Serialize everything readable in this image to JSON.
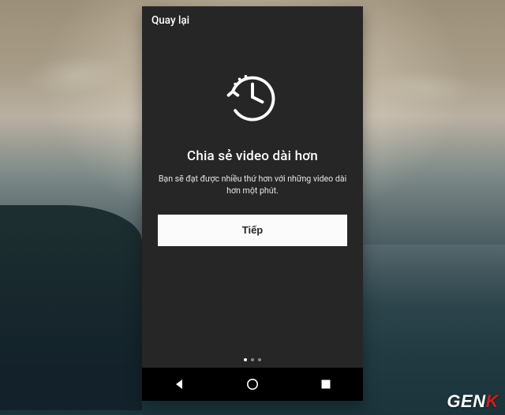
{
  "header": {
    "back": "Quay lại"
  },
  "main": {
    "icon": "clock-history-icon",
    "title": "Chia sẻ video dài hơn",
    "subtitle": "Bạn sẽ đạt được nhiều thứ hơn với những video dài hơn một phút.",
    "primary_action": "Tiếp",
    "pager": {
      "count": 3,
      "active": 0
    }
  },
  "navbar": {
    "back": "back",
    "home": "home",
    "recent": "recent"
  },
  "watermark": {
    "brand_a": "GEN",
    "brand_b": "K"
  }
}
